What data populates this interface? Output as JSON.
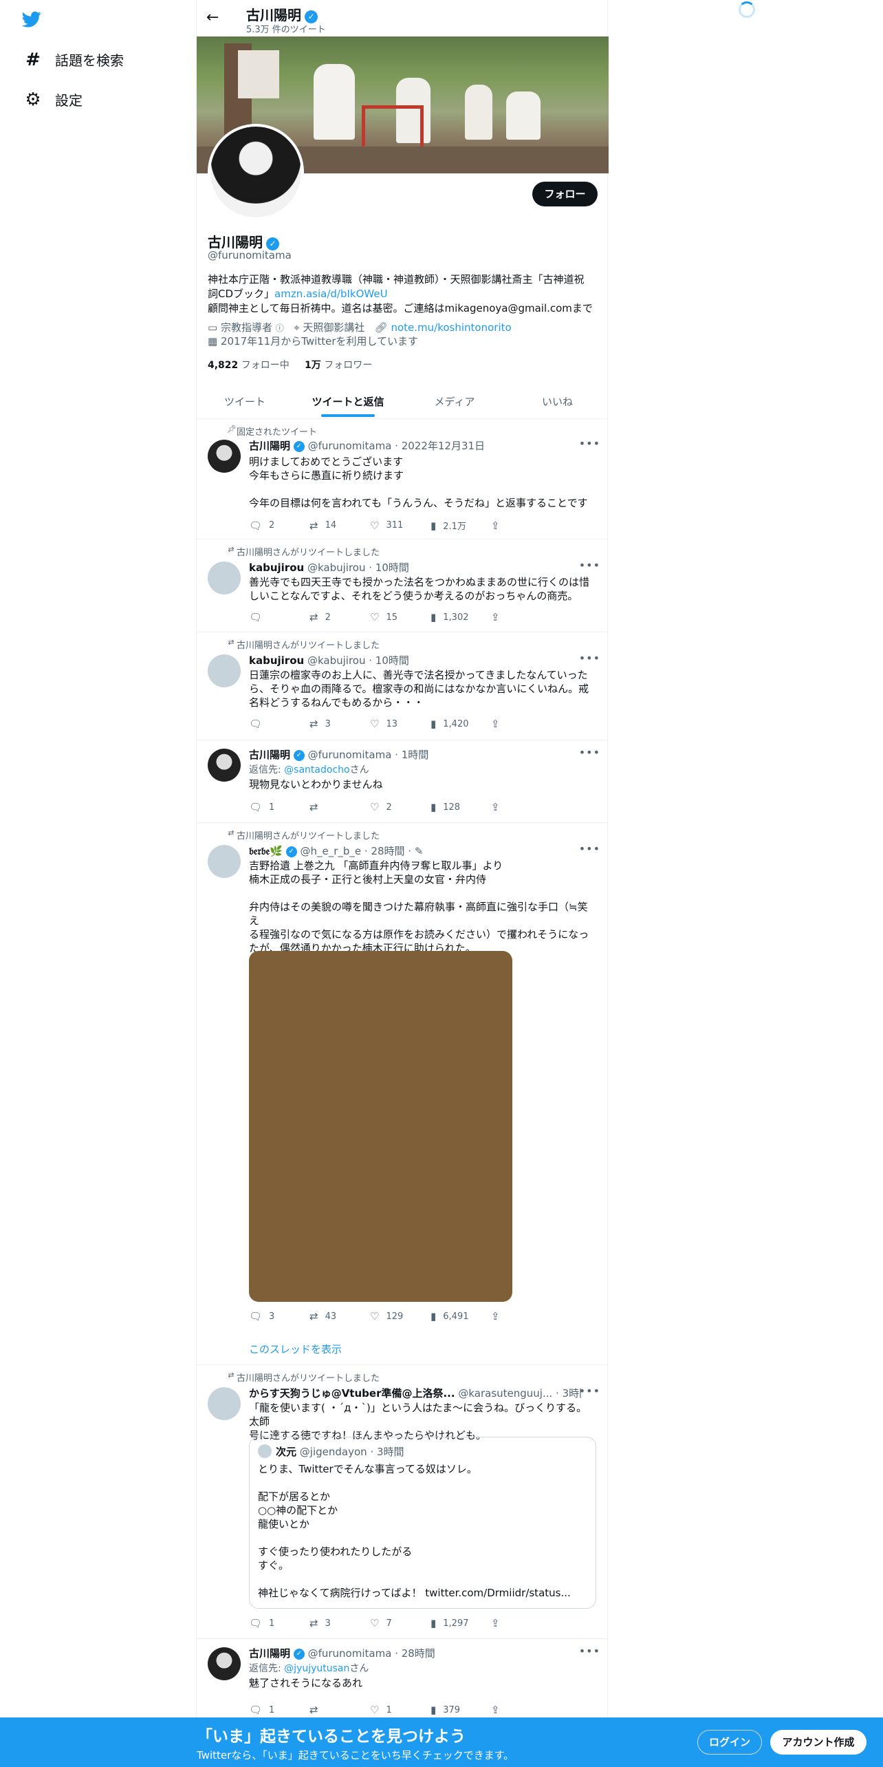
{
  "sidebar": {
    "logo": "twitter-bird",
    "items": [
      {
        "label": "話題を検索",
        "icon": "hashtag"
      },
      {
        "label": "設定",
        "icon": "gear"
      }
    ]
  },
  "header": {
    "name": "古川陽明",
    "tweet_count": "5.3万 件のツイート"
  },
  "profile": {
    "name": "古川陽明",
    "handle": "@furunomitama",
    "follow_label": "フォロー",
    "bio_line1": "神社本庁正階・教派神道教導職（神職・神道教師）・天照御影講社斎主「古神道祝",
    "bio_line2": "詞CDブック」",
    "bio_link": "amzn.asia/d/bIkOWeU",
    "bio_line3": "顧問神主として毎日祈祷中。道名は基密。ご連絡はmikagenoya@gmail.comまで",
    "category": "宗教指導者",
    "location": "天照御影講社",
    "website": "note.mu/koshintonorito",
    "joined": "2017年11月からTwitterを利用しています",
    "following_count": "4,822",
    "following_label": "フォロー中",
    "followers_count": "1万",
    "followers_label": "フォロワー"
  },
  "tabs": [
    "ツイート",
    "ツイートと返信",
    "メディア",
    "いいね"
  ],
  "active_tab": "ツイートと返信",
  "tweets": [
    {
      "context": "固定されたツイート",
      "name": "古川陽明",
      "handle": "@furunomitama",
      "time": "2022年12月31日",
      "lines": [
        "明けましておめでとうございます",
        "今年もさらに愚直に祈り続けます",
        "",
        "今年の目標は何を言われても「うんうん、そうだね」と返事することです"
      ],
      "replies": "2",
      "retweets": "14",
      "likes": "311",
      "views": "2.1万"
    },
    {
      "context": "古川陽明さんがリツイートしました",
      "name": "kabujirou",
      "handle": "@kabujirou",
      "time": "10時間",
      "lines": [
        "善光寺でも四天王寺でも授かった法名をつかわぬままあの世に行くのは惜",
        "しいことなんですよ、それをどう使うか考えるのがおっちゃんの商売。"
      ],
      "replies": "",
      "retweets": "2",
      "likes": "15",
      "views": "1,302"
    },
    {
      "context": "古川陽明さんがリツイートしました",
      "name": "kabujirou",
      "handle": "@kabujirou",
      "time": "10時間",
      "lines": [
        "日蓮宗の檀家寺のお上人に、善光寺で法名授かってきましたなんていった",
        "ら、そりゃ血の雨降るで。檀家寺の和尚にはなかなか言いにくいねん。戒",
        "名料どうするねんでもめるから・・・"
      ],
      "replies": "",
      "retweets": "3",
      "likes": "13",
      "views": "1,420"
    },
    {
      "context": "",
      "name": "古川陽明",
      "handle": "@furunomitama",
      "time": "1時間",
      "reply_prefix": "返信先: ",
      "reply_to": "@santadocho",
      "reply_suffix": "さん",
      "lines": [
        "現物見ないとわかりませんね"
      ],
      "replies": "1",
      "retweets": "",
      "likes": "2",
      "views": "128"
    },
    {
      "context": "古川陽明さんがリツイートしました",
      "name": "𝔟𝔢𝔯𝔟𝔢🌿",
      "handle": "@h_e_r_b_e",
      "time": "28時間",
      "lines": [
        "吉野拾遺 上巻之九 「高師直弁内侍ヲ奪ヒ取ル事」より",
        "楠木正成の長子・正行と後村上天皇の女官・弁内侍",
        "",
        "弁内侍はその美貌の噂を聞きつけた幕府執事・高師直に強引な手口（≒笑え",
        "る程強引なので気になる方は原作をお読みください）で攫われそうになっ",
        "たが、偶然通りかかった楠木正行に助けられた。"
      ],
      "replies": "3",
      "retweets": "43",
      "likes": "129",
      "views": "6,491",
      "thread_link": "このスレッドを表示"
    },
    {
      "context": "古川陽明さんがリツイートしました",
      "name": "からす天狗うじゅ@Vtuber準備@上洛祭...",
      "handle": "@karasutenguuj...",
      "time": "3時間",
      "lines": [
        "「龍を使います( ・´д・`)」という人はたま～に会うね。びっくりする。太師",
        "号に達する徳ですね！ほんまやったらやけれども。"
      ],
      "quote": {
        "name": "次元",
        "handle": "@jigendayon",
        "time": "3時間",
        "lines": [
          "とりま、Twitterでそんな事言ってる奴はソレ。",
          "",
          "配下が居るとか",
          "○○神の配下とか",
          "龍使いとか",
          "",
          "すぐ使ったり使われたりしたがる",
          "すぐ。",
          "",
          "神社じゃなくて病院行けってばよ！ twitter.com/Drmiidr/status..."
        ]
      },
      "replies": "1",
      "retweets": "3",
      "likes": "7",
      "views": "1,297"
    },
    {
      "context": "",
      "name": "古川陽明",
      "handle": "@furunomitama",
      "time": "28時間",
      "reply_prefix": "返信先: ",
      "reply_to": "@jyujyutusan",
      "reply_suffix": "さん",
      "lines": [
        "魅了されそうになるあれ"
      ],
      "replies": "1",
      "retweets": "",
      "likes": "1",
      "views": "379"
    }
  ],
  "banner": {
    "title": "「いま」起きていることを見つけよう",
    "subtitle": "Twitterなら、「いま」起きていることをいち早くチェックできます。",
    "login": "ログイン",
    "signup": "アカウント作成"
  },
  "colors": {
    "accent": "#1d9bf0",
    "text": "#0f1419",
    "muted": "#536471",
    "media": "#7f5f38"
  }
}
